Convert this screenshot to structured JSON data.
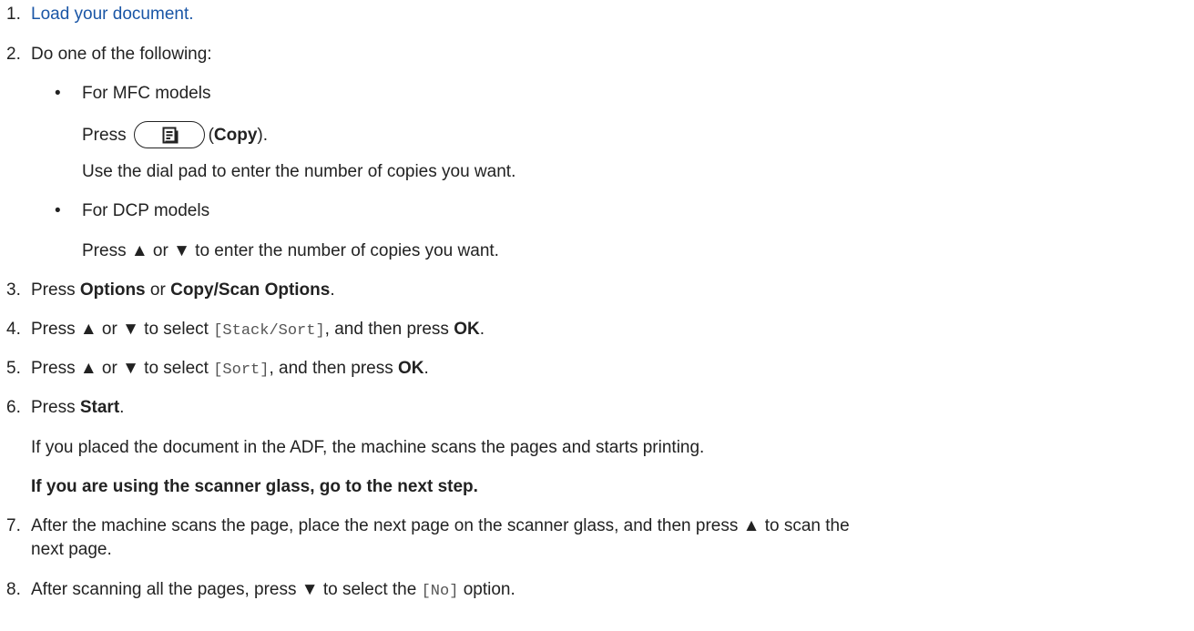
{
  "steps": {
    "s1": {
      "num": "1.",
      "link": "Load your document."
    },
    "s2": {
      "num": "2.",
      "text": "Do one of the following:",
      "bullet": "•",
      "mfc": {
        "label": "For MFC models",
        "press": "Press",
        "paren_open": "(",
        "copy": "Copy",
        "paren_close": ").",
        "icon": "copy-button-icon",
        "dial": "Use the dial pad to enter the number of copies you want."
      },
      "dcp": {
        "label": "For DCP models",
        "text": "Press ▲ or ▼ to enter the number of copies you want."
      }
    },
    "s3": {
      "num": "3.",
      "pre": "Press ",
      "b1": "Options",
      "mid": " or ",
      "b2": "Copy/Scan Options",
      "post": "."
    },
    "s4": {
      "num": "4.",
      "pre": "Press ▲ or ▼ to select ",
      "code": "[Stack/Sort]",
      "mid": ", and then press ",
      "b": "OK",
      "post": "."
    },
    "s5": {
      "num": "5.",
      "pre": "Press ▲ or ▼ to select ",
      "code": "[Sort]",
      "mid": ", and then press ",
      "b": "OK",
      "post": "."
    },
    "s6": {
      "num": "6.",
      "pre": "Press ",
      "b": "Start",
      "post": ".",
      "adf": "If you placed the document in the ADF, the machine scans the pages and starts printing.",
      "glass": "If you are using the scanner glass, go to the next step."
    },
    "s7": {
      "num": "7.",
      "line1": "After the machine scans the page, place the next page on the scanner glass, and then press ▲ to scan the",
      "line2": "next page."
    },
    "s8": {
      "num": "8.",
      "pre": "After scanning all the pages, press ▼ to select the ",
      "code": "[No]",
      "post": " option."
    }
  }
}
